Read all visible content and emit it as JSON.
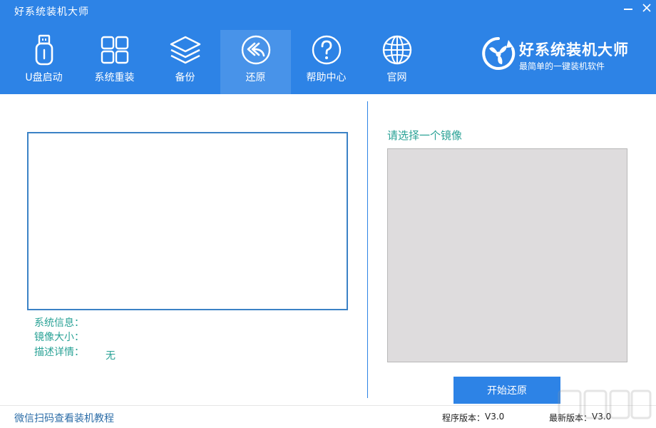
{
  "window": {
    "title": "好系统装机大师"
  },
  "nav": {
    "items": [
      {
        "label": "U盘启动",
        "icon": "usb-drive-icon"
      },
      {
        "label": "系统重装",
        "icon": "windows-grid-icon"
      },
      {
        "label": "备份",
        "icon": "layers-icon"
      },
      {
        "label": "还原",
        "icon": "restore-rewind-icon"
      },
      {
        "label": "帮助中心",
        "icon": "help-circle-icon"
      },
      {
        "label": "官网",
        "icon": "globe-icon"
      }
    ],
    "active_index": 3
  },
  "brand": {
    "name": "好系统装机大师",
    "slogan": "最简单的一键装机软件"
  },
  "info": {
    "system_info_label": "系统信息：",
    "image_size_label": "镜像大小：",
    "description_label": "描述详情：",
    "description_value": "无"
  },
  "image_panel": {
    "prompt": "请选择一个镜像"
  },
  "actions": {
    "restore_label": "开始还原"
  },
  "footer": {
    "tutorial_link": "微信扫码查看装机教程",
    "program_version_label": "程序版本：",
    "program_version_value": "V3.0",
    "latest_version_label": "最新版本：",
    "latest_version_value": "V3.0"
  },
  "colors": {
    "primary": "#2d83e6",
    "teal_text": "#2aa296",
    "list_bg": "#dedcdd"
  }
}
